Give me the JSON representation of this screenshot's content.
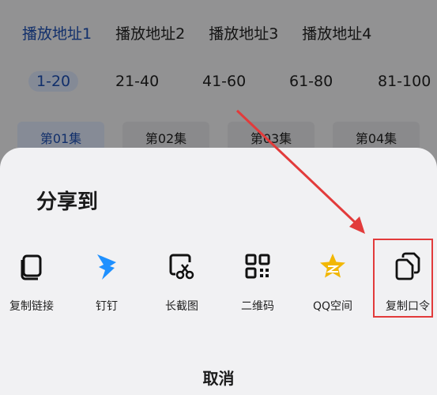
{
  "background": {
    "source_tabs": [
      {
        "label": "播放地址1",
        "active": true
      },
      {
        "label": "播放地址2",
        "active": false
      },
      {
        "label": "播放地址3",
        "active": false
      },
      {
        "label": "播放地址4",
        "active": false
      }
    ],
    "ranges": [
      {
        "label": "1-20",
        "active": true
      },
      {
        "label": "21-40",
        "active": false
      },
      {
        "label": "41-60",
        "active": false
      },
      {
        "label": "61-80",
        "active": false
      },
      {
        "label": "81-100",
        "active": false
      }
    ],
    "episodes": [
      {
        "label": "第01集",
        "active": true
      },
      {
        "label": "第02集",
        "active": false
      },
      {
        "label": "第03集",
        "active": false
      },
      {
        "label": "第04集",
        "active": false
      }
    ]
  },
  "sheet": {
    "title": "分享到",
    "items": [
      {
        "label": "复制链接",
        "icon": "copy-link-icon"
      },
      {
        "label": "钉钉",
        "icon": "dingtalk-icon"
      },
      {
        "label": "长截图",
        "icon": "long-screenshot-icon"
      },
      {
        "label": "二维码",
        "icon": "qr-code-icon"
      },
      {
        "label": "QQ空间",
        "icon": "qzone-star-icon"
      },
      {
        "label": "复制口令",
        "icon": "copy-command-icon"
      }
    ],
    "cancel_label": "取消"
  },
  "colors": {
    "accent_blue": "#1d4fb2",
    "annotation_red": "#e23b3b",
    "qzone_gold": "#f2b705"
  }
}
